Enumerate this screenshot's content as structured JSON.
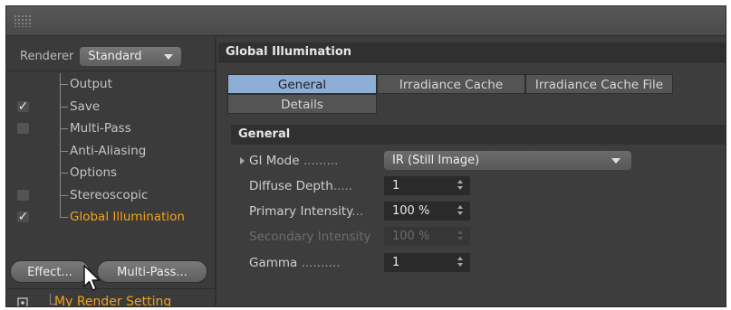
{
  "renderer": {
    "label": "Renderer",
    "value": "Standard"
  },
  "tree": [
    {
      "label": "Output",
      "checkbox": "none"
    },
    {
      "label": "Save",
      "checkbox": "checked"
    },
    {
      "label": "Multi-Pass",
      "checkbox": "unchecked"
    },
    {
      "label": "Anti-Aliasing",
      "checkbox": "none"
    },
    {
      "label": "Options",
      "checkbox": "none"
    },
    {
      "label": "Stereoscopic",
      "checkbox": "unchecked"
    },
    {
      "label": "Global Illumination",
      "checkbox": "checked",
      "selected": true
    }
  ],
  "buttons": {
    "effect": "Effect...",
    "multipass": "Multi-Pass..."
  },
  "render_setting": "My Render Setting",
  "panel": {
    "title": "Global Illumination",
    "tabs": [
      "General",
      "Irradiance Cache",
      "Irradiance Cache File",
      "Details"
    ],
    "active_tab": "General",
    "section": "General",
    "params": [
      {
        "label": "GI Mode",
        "dots": " .........",
        "value": "IR (Still Image)",
        "kind": "dropdown"
      },
      {
        "label": "Diffuse Depth",
        "dots": ".....",
        "value": "1",
        "kind": "number"
      },
      {
        "label": "Primary Intensity",
        "dots": "...",
        "value": "100 %",
        "kind": "number"
      },
      {
        "label": "Secondary Intensity",
        "dots": "",
        "value": "100 %",
        "kind": "number",
        "disabled": true
      },
      {
        "label": "Gamma",
        "dots": " ..........",
        "value": "1",
        "kind": "number"
      }
    ]
  },
  "colors": {
    "selected_text": "#f2a21c",
    "active_tab": "#8eaed6",
    "background": "#3d3d3d"
  }
}
